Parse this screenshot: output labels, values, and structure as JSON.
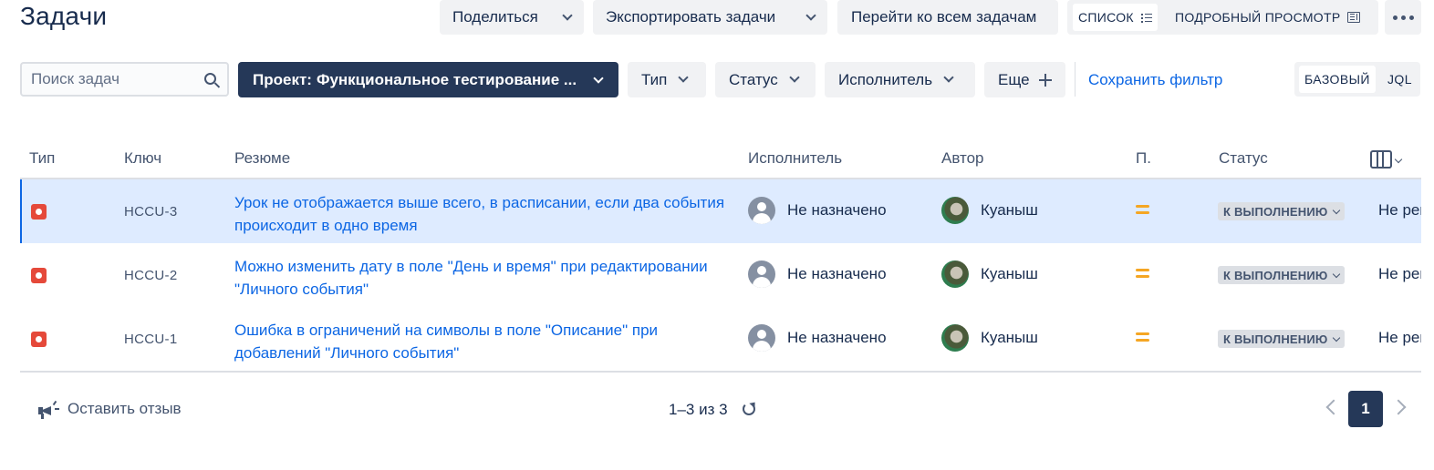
{
  "page": {
    "title": "Задачи"
  },
  "toolbar": {
    "share_label": "Поделиться",
    "export_label": "Экспортировать задачи",
    "goto_all_label": "Перейти ко всем задачам",
    "view_list_label": "СПИСОК",
    "view_detail_label": "ПОДРОБНЫЙ ПРОСМОТР",
    "active_view": "list"
  },
  "filters": {
    "search_placeholder": "Поиск задач",
    "search_value": "",
    "project_label": "Проект:",
    "project_value": "Функциональное тестирование ...",
    "type_label": "Тип",
    "status_label": "Статус",
    "assignee_label": "Исполнитель",
    "more_label": "Еще",
    "save_filter_label": "Сохранить фильтр",
    "mode_basic_label": "БАЗОВЫЙ",
    "mode_jql_label": "JQL",
    "active_mode": "basic"
  },
  "table": {
    "columns": [
      "Тип",
      "Ключ",
      "Резюме",
      "Исполнитель",
      "Автор",
      "П.",
      "Статус"
    ],
    "rows": [
      {
        "type_icon": "bug-icon",
        "key": "HCCU-3",
        "summary": "Урок не отображается выше всего, в расписании, если два события происходит в одно время",
        "assignee": "Не назначено",
        "author": "Куаныш",
        "priority_icon": "priority-medium-icon",
        "status": "К ВЫПОЛНЕНИЮ",
        "resolution": "Не решено",
        "selected": true
      },
      {
        "type_icon": "bug-icon",
        "key": "HCCU-2",
        "summary": "Можно изменить дату в поле \"День и время\" при редактировании \"Личного события\"",
        "assignee": "Не назначено",
        "author": "Куаныш",
        "priority_icon": "priority-medium-icon",
        "status": "К ВЫПОЛНЕНИЮ",
        "resolution": "Не решено",
        "selected": false
      },
      {
        "type_icon": "bug-icon",
        "key": "HCCU-1",
        "summary": "Ошибка в ограничений на символы в поле \"Описание\" при добавлений \"Личного события\"",
        "assignee": "Не назначено",
        "author": "Куаныш",
        "priority_icon": "priority-medium-icon",
        "status": "К ВЫПОЛНЕНИЮ",
        "resolution": "Не решено",
        "selected": false
      }
    ]
  },
  "footer": {
    "feedback_label": "Оставить отзыв",
    "page_count": "1–3 из 3",
    "current_page": "1"
  },
  "colors": {
    "accent": "#0c66e4",
    "dark_button": "#253858",
    "bug": "#e5493a",
    "priority_medium": "#f5a623",
    "selected_row": "#deebff"
  }
}
